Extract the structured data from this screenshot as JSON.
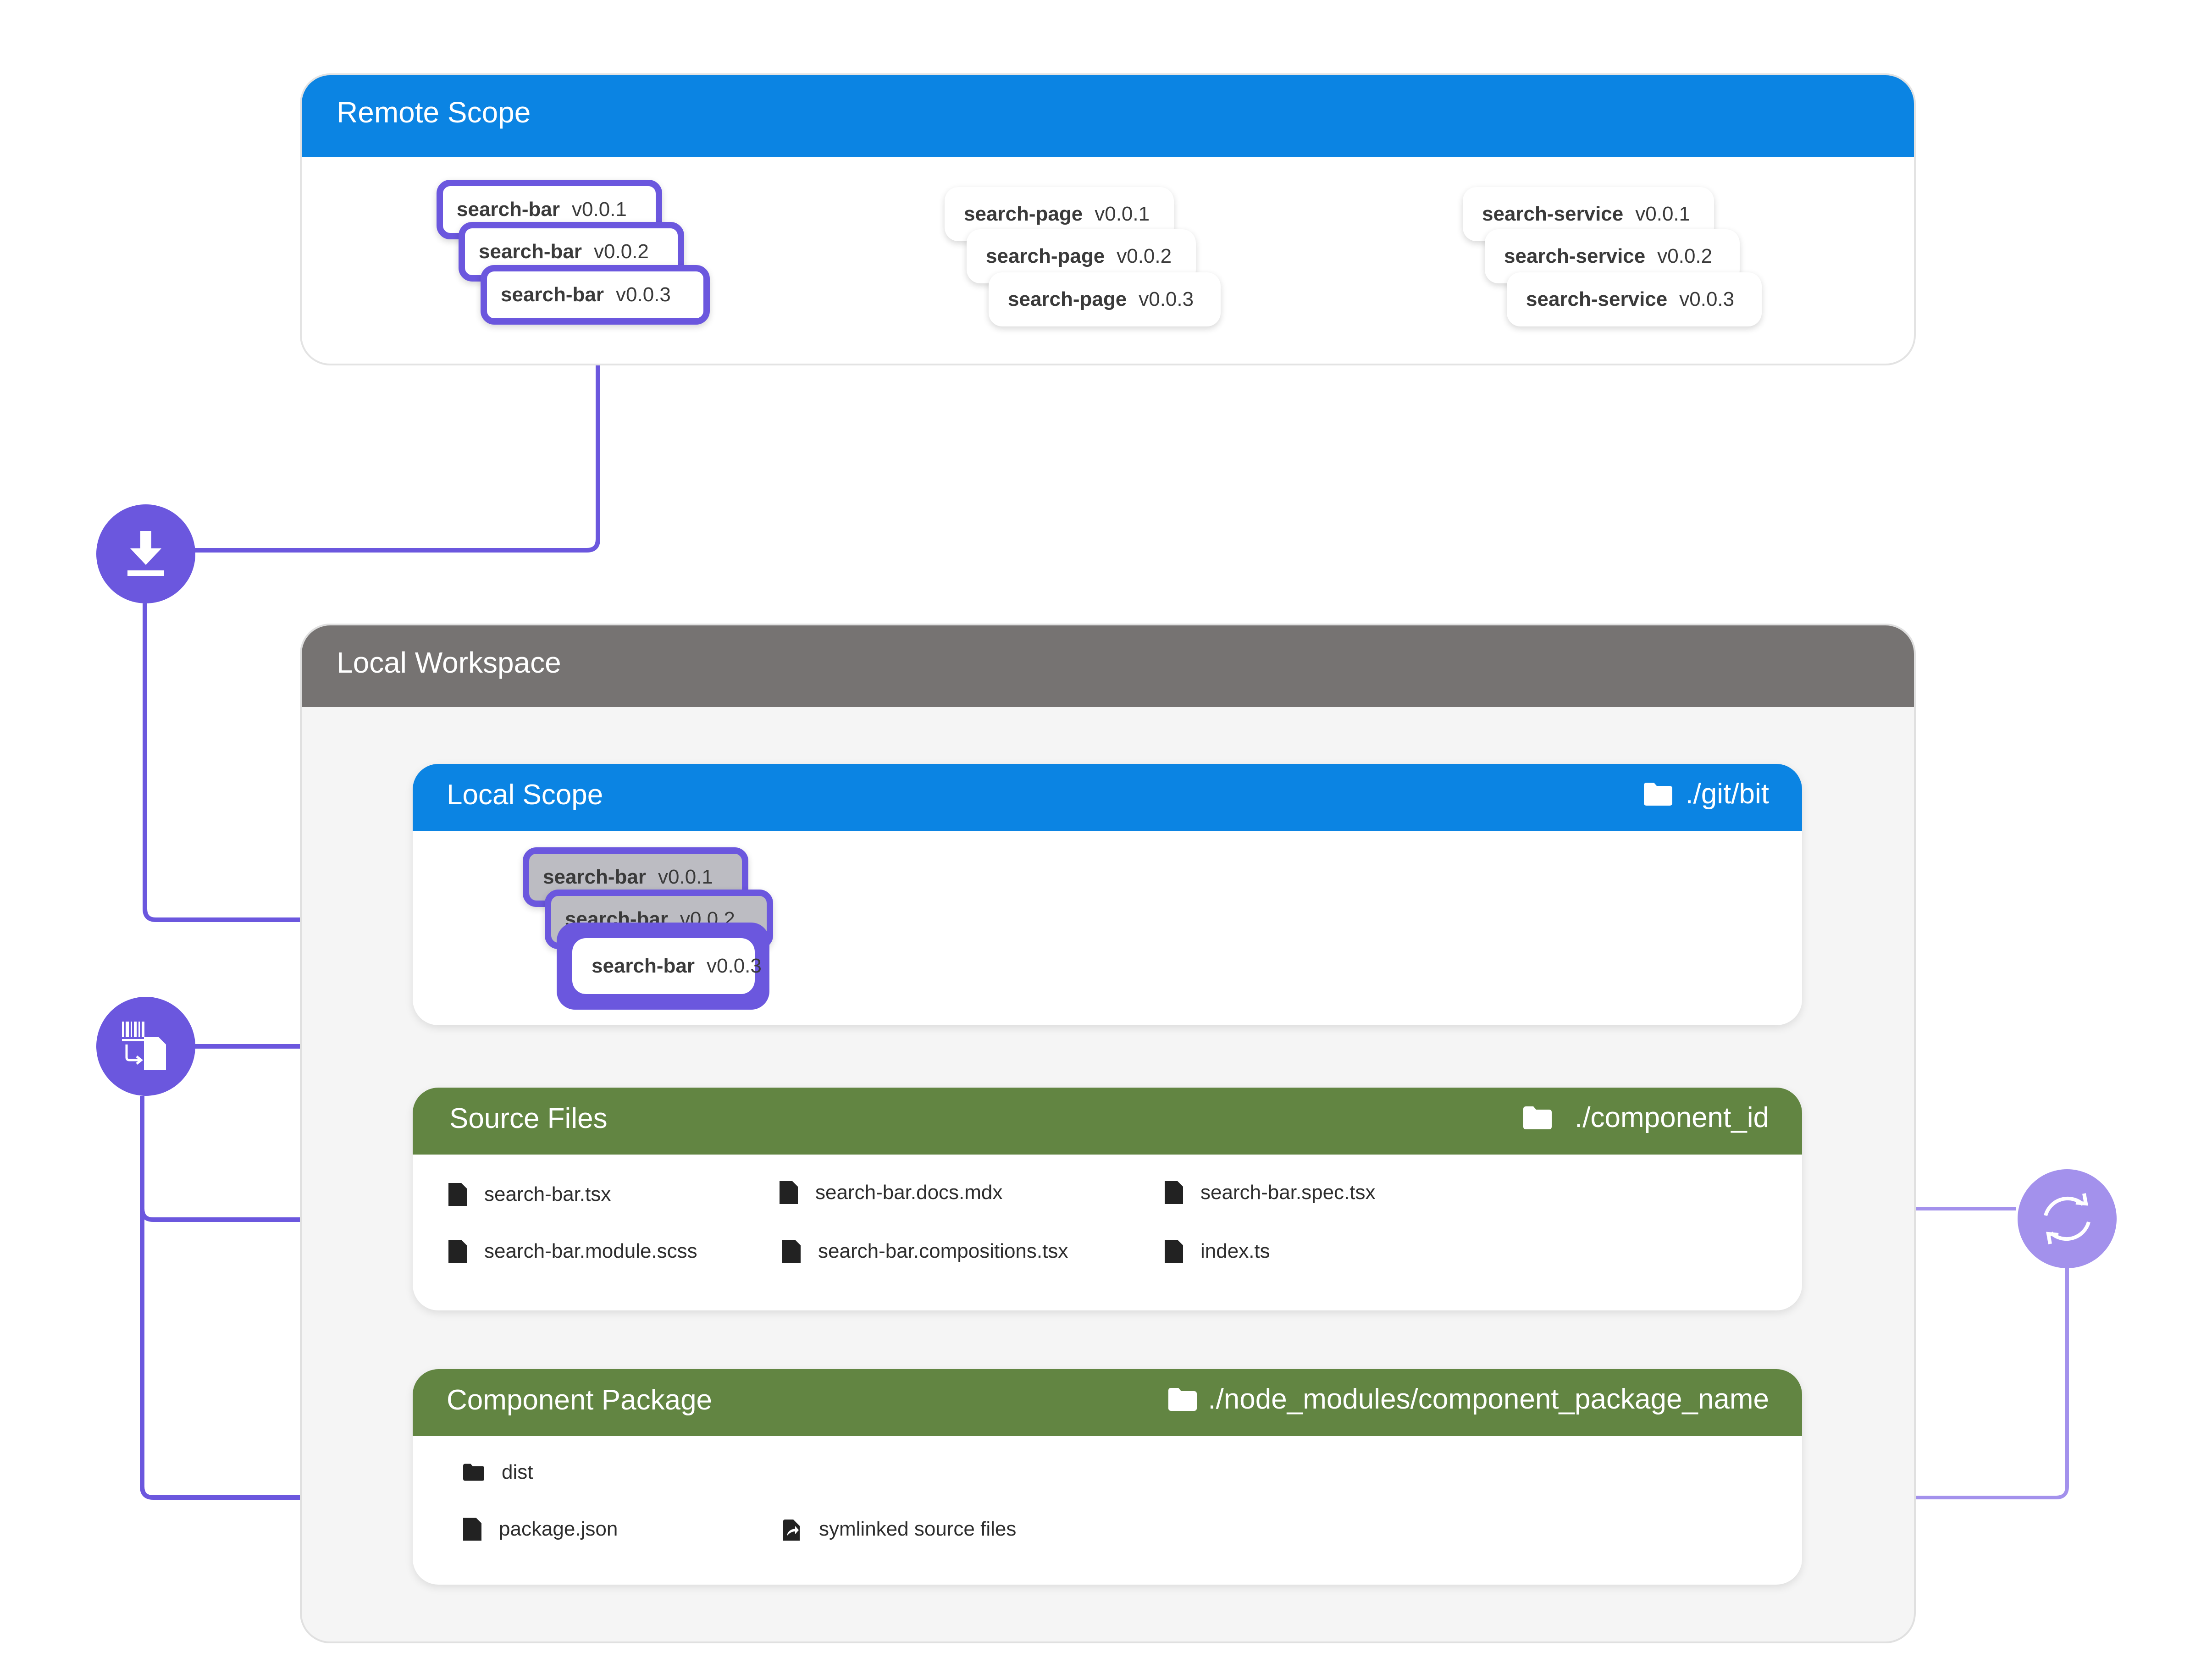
{
  "remote_scope": {
    "title": "Remote Scope",
    "components": [
      {
        "name": "search-bar",
        "versions": [
          "v0.0.1",
          "v0.0.2",
          "v0.0.3"
        ],
        "selected": true
      },
      {
        "name": "search-page",
        "versions": [
          "v0.0.1",
          "v0.0.2",
          "v0.0.3"
        ],
        "selected": false
      },
      {
        "name": "search-service",
        "versions": [
          "v0.0.1",
          "v0.0.2",
          "v0.0.3"
        ],
        "selected": false
      }
    ]
  },
  "local_workspace": {
    "title": "Local Workspace",
    "local_scope": {
      "title": "Local Scope",
      "path": "./git/bit",
      "component": {
        "name": "search-bar",
        "versions": [
          "v0.0.1",
          "v0.0.2",
          "v0.0.3"
        ],
        "active_version": "v0.0.3"
      }
    },
    "source_files": {
      "title": "Source Files",
      "path": "./component_id",
      "files": [
        "search-bar.tsx",
        "search-bar.docs.mdx",
        "search-bar.spec.tsx",
        "search-bar.module.scss",
        "search-bar.compositions.tsx",
        "index.ts"
      ]
    },
    "component_package": {
      "title": "Component Package",
      "path": "./node_modules/component_package_name",
      "items": [
        {
          "label": "dist",
          "icon": "folder-icon"
        },
        {
          "label": "package.json",
          "icon": "file-icon"
        },
        {
          "label": "symlinked source files",
          "icon": "symlink-icon"
        }
      ]
    }
  },
  "actions": {
    "import": {
      "icon": "download-icon"
    },
    "checkout": {
      "icon": "checkout-icon"
    },
    "sync": {
      "icon": "sync-icon"
    }
  },
  "colors": {
    "scope_blue": "#0b84e3",
    "workspace_grey": "#767372",
    "files_green": "#628542",
    "accent_purple": "#6b57de",
    "light_purple": "#a391ec"
  }
}
